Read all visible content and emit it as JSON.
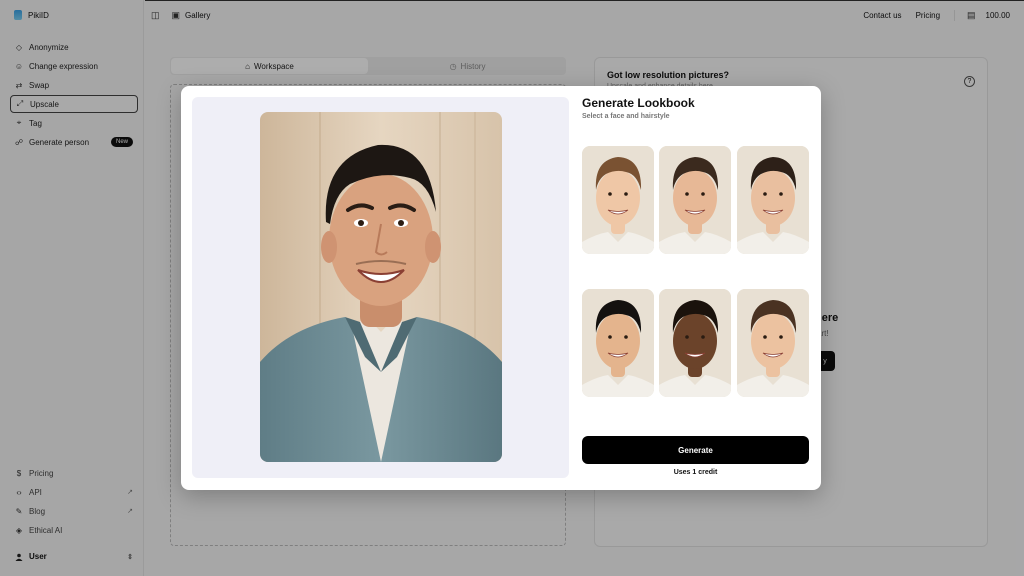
{
  "app": {
    "name": "PikiID"
  },
  "sidebar": {
    "items": [
      {
        "label": "Anonymize",
        "icon": "anonymize-icon"
      },
      {
        "label": "Change expression",
        "icon": "smile-icon"
      },
      {
        "label": "Swap",
        "icon": "swap-icon"
      },
      {
        "label": "Upscale",
        "icon": "upscale-icon",
        "active": true
      },
      {
        "label": "Tag",
        "icon": "tag-icon"
      },
      {
        "label": "Generate person",
        "icon": "people-icon",
        "badge": "New"
      }
    ],
    "bottom": [
      {
        "label": "Pricing",
        "icon": "dollar-icon"
      },
      {
        "label": "API",
        "icon": "code-icon"
      },
      {
        "label": "Blog",
        "icon": "blog-icon"
      },
      {
        "label": "Ethical AI",
        "icon": "shield-icon"
      }
    ],
    "user": "User"
  },
  "topbar": {
    "gallery": "Gallery",
    "contact": "Contact us",
    "pricing": "Pricing",
    "credits": "100.00"
  },
  "workspace": {
    "tab_workspace": "Workspace",
    "tab_history": "History"
  },
  "right_panel": {
    "title": "Got low resolution pictures?",
    "subtitle": "Upscale and enhance details here",
    "heading": "here",
    "text": "art!",
    "button": "y"
  },
  "modal": {
    "title": "Generate Lookbook",
    "subtitle": "Select a face and hairstyle",
    "generate_label": "Generate",
    "credit_note": "Uses 1 credit"
  },
  "thumbnails": [
    {
      "skin": "#efc7a6",
      "hair": "#7a5232"
    },
    {
      "skin": "#e7b896",
      "hair": "#3b2a1e"
    },
    {
      "skin": "#e9bf9f",
      "hair": "#2d2018"
    },
    {
      "skin": "#e4b48d",
      "hair": "#14110f"
    },
    {
      "skin": "#6b432a",
      "hair": "#1a120c"
    },
    {
      "skin": "#ecc2a0",
      "hair": "#4a3222"
    }
  ]
}
